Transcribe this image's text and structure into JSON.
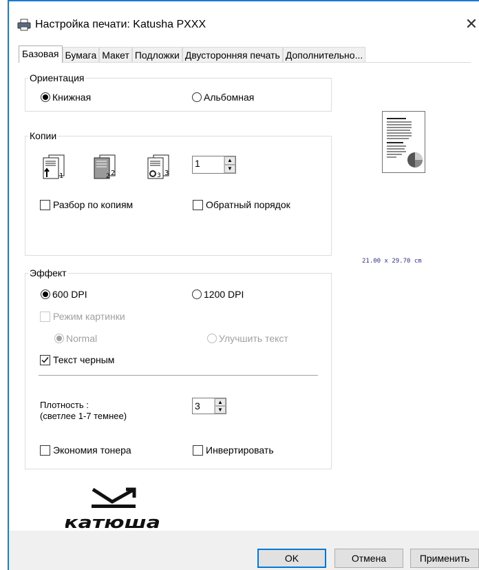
{
  "window": {
    "title": "Настройка печати: Katusha PXXX"
  },
  "tabs": [
    {
      "label": "Базовая"
    },
    {
      "label": "Бумага"
    },
    {
      "label": "Макет"
    },
    {
      "label": "Подложки"
    },
    {
      "label": "Двусторонняя печать"
    },
    {
      "label": "Дополнительно..."
    }
  ],
  "orientation": {
    "title": "Ориентация",
    "portrait": "Книжная",
    "landscape": "Альбомная",
    "selected": "portrait"
  },
  "copies": {
    "title": "Копии",
    "count": "1",
    "collate_label": "Разбор по копиям",
    "collate_checked": false,
    "reverse_label": "Обратный порядок",
    "reverse_checked": false,
    "icon_numbers": [
      "1",
      "2",
      "3"
    ]
  },
  "effect": {
    "title": "Эффект",
    "dpi600": "600 DPI",
    "dpi1200": "1200 DPI",
    "selected_dpi": "600",
    "picture_mode_label": "Режим картинки",
    "normal_label": "Normal",
    "improve_text_label": "Улучшить текст",
    "black_text_label": "Текст черным",
    "black_text_checked": true,
    "density_label_line1": "Плотность :",
    "density_label_line2": "(светлее 1-7 темнее)",
    "density_value": "3",
    "toner_save_label": "Экономия тонера",
    "invert_label": "Инвертировать"
  },
  "preview": {
    "paper_size": "21.00 x 29.70 cm"
  },
  "logo": {
    "text": "катюша"
  },
  "buttons": {
    "ok": "OK",
    "cancel": "Отмена",
    "apply": "Применить"
  },
  "colors": {
    "accent": "#0078d7",
    "window_border": "#1a7ad8"
  }
}
